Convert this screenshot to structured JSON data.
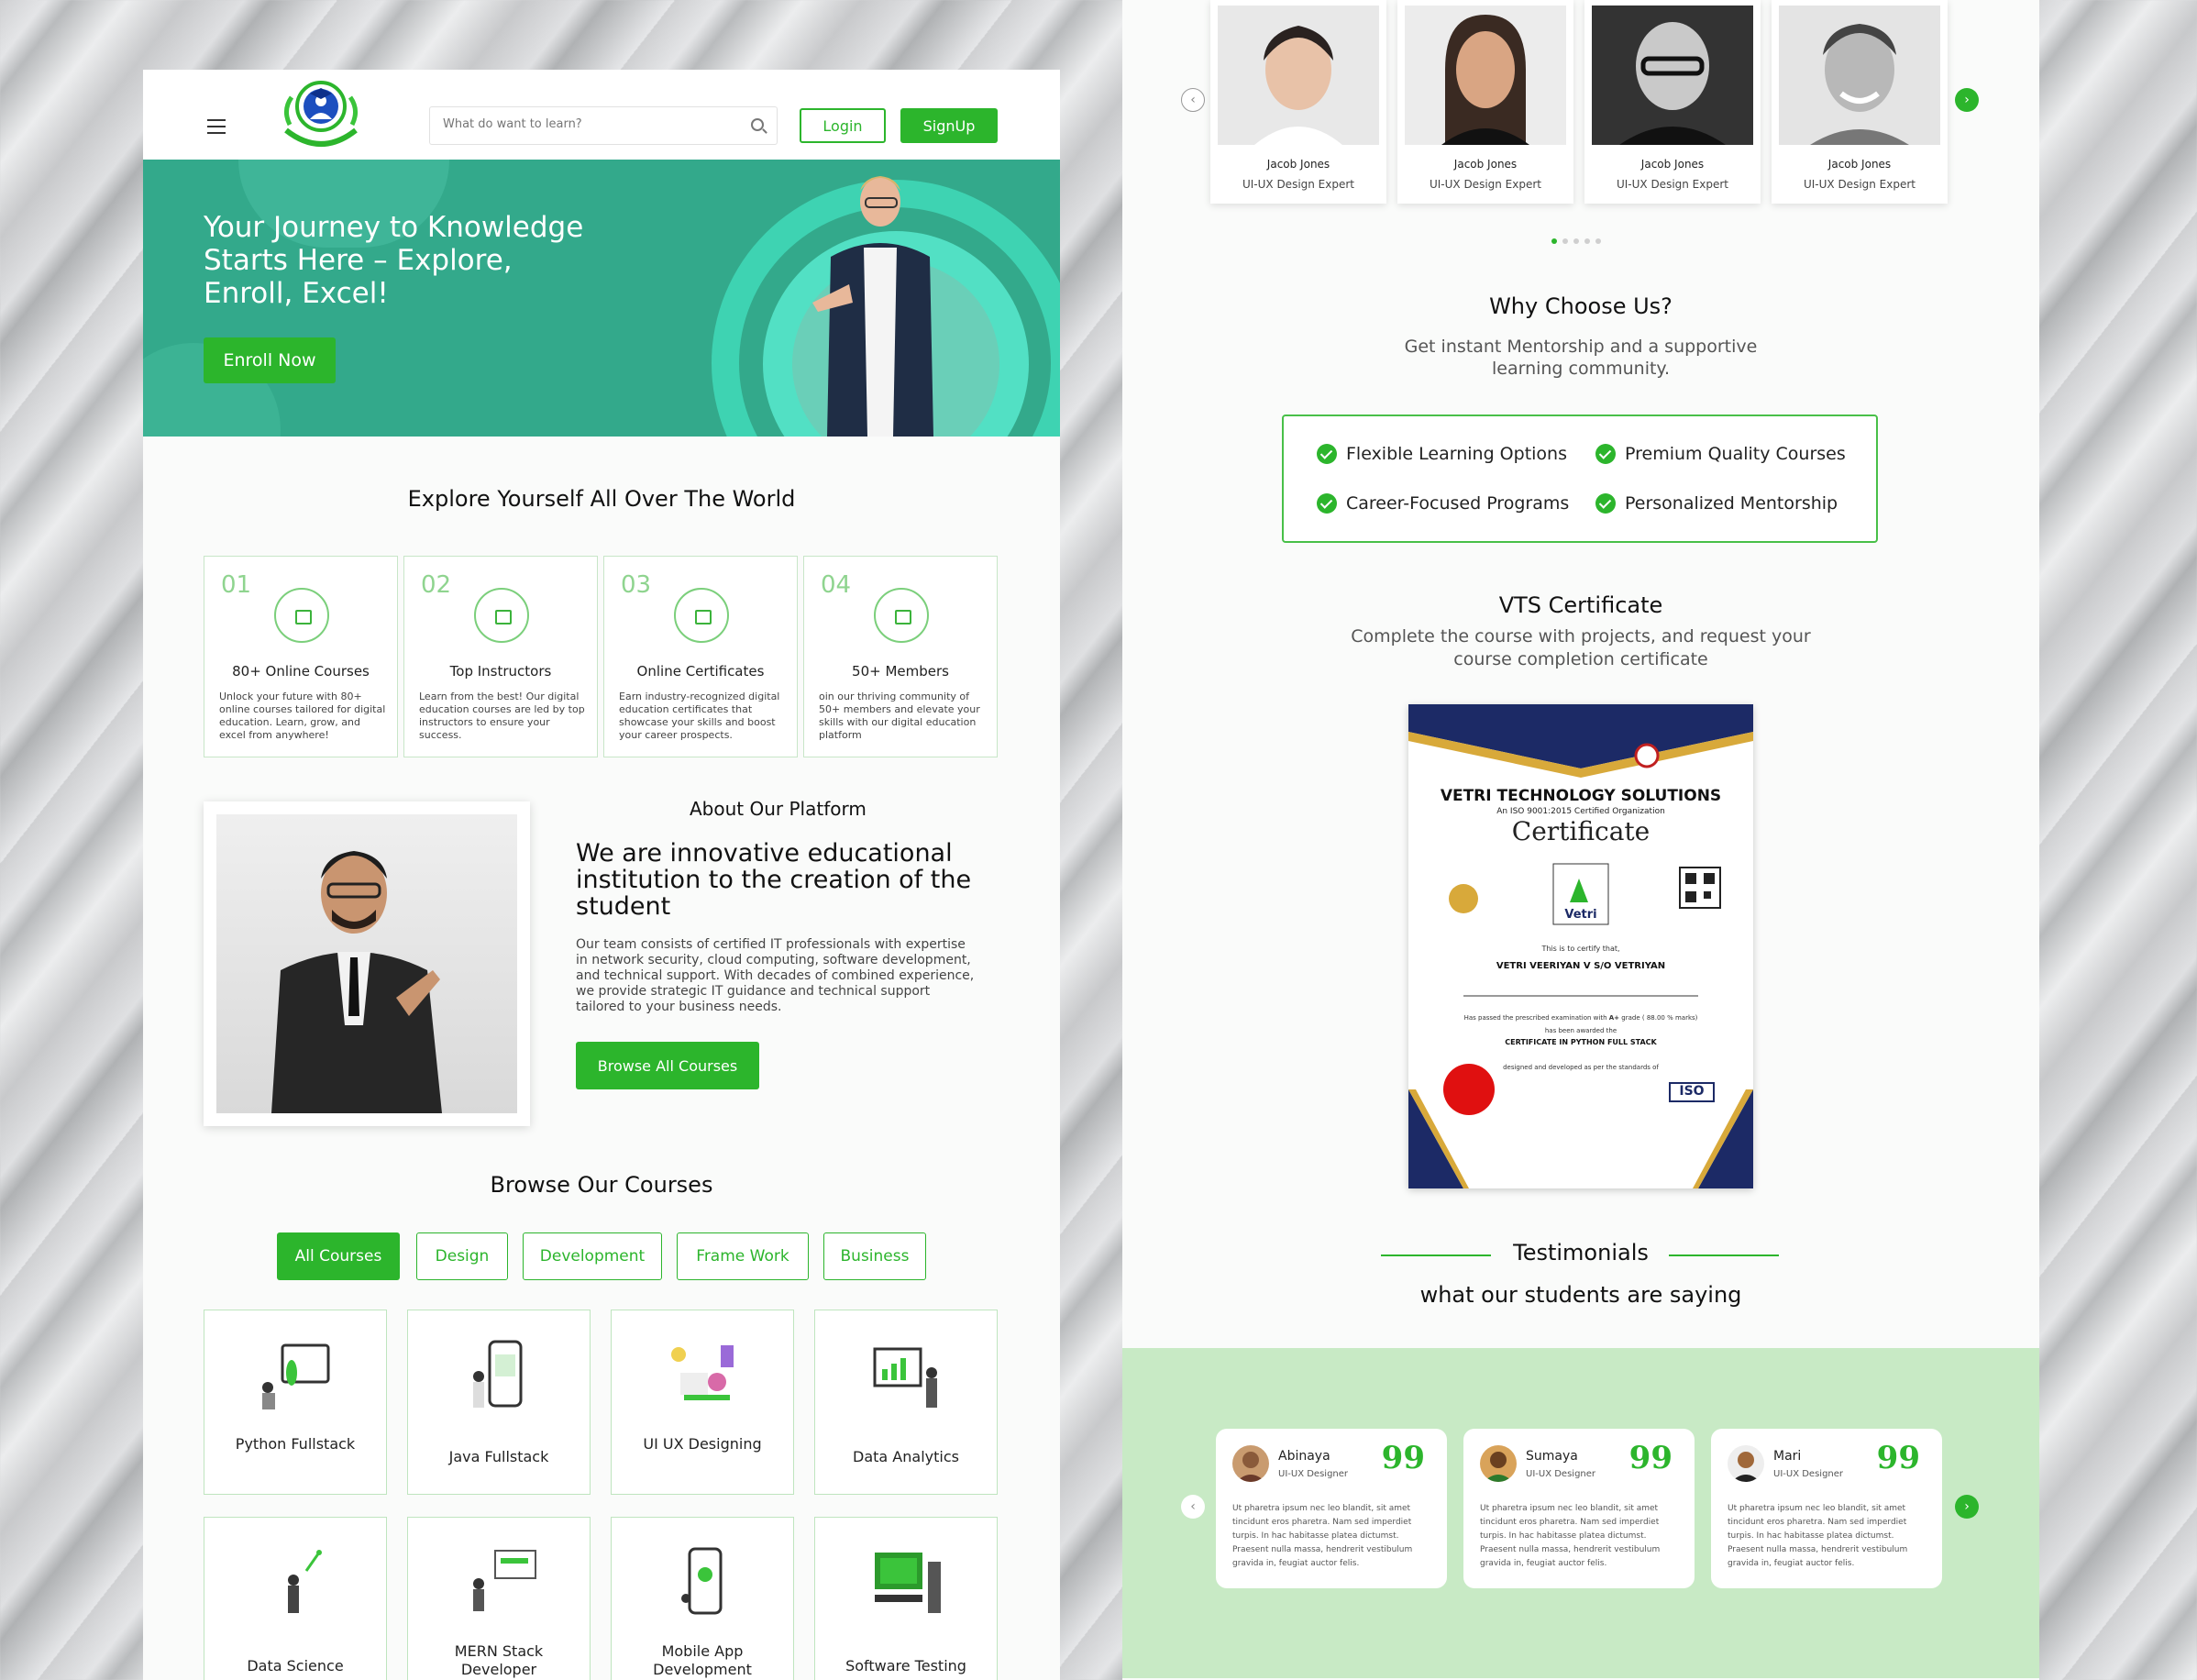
{
  "header": {
    "search_placeholder": "What do want to learn?",
    "login": "Login",
    "signup": "SignUp"
  },
  "hero": {
    "title": "Your Journey to Knowledge Starts Here – Explore, Enroll, Excel!",
    "cta": "Enroll Now"
  },
  "explore": {
    "title": "Explore Yourself All Over The World",
    "features": [
      {
        "num": "01",
        "title": "80+ Online Courses",
        "text": "Unlock your future with 80+ online courses tailored for digital education. Learn, grow, and excel from anywhere!"
      },
      {
        "num": "02",
        "title": "Top Instructors",
        "text": "Learn from the best! Our digital education courses are led by top instructors to ensure your success."
      },
      {
        "num": "03",
        "title": "Online Certificates",
        "text": "Earn industry-recognized digital education certificates that showcase your skills and boost your career prospects."
      },
      {
        "num": "04",
        "title": "50+  Members",
        "text": "oin our thriving community of 50+ members and elevate your skills with our digital education platform"
      }
    ]
  },
  "about": {
    "label": "About Our Platform",
    "heading": "We are innovative educational institution to the creation of the student",
    "text": "Our team consists of certified IT professionals with expertise in network security, cloud computing, software development, and technical support. With decades of combined experience, we provide strategic IT guidance and technical support tailored to your business needs.",
    "cta": "Browse All Courses"
  },
  "courses": {
    "title": "Browse Our Courses",
    "filters": [
      "All Courses",
      "Design",
      "Development",
      "Frame Work",
      "Business"
    ],
    "items": [
      "Python Fullstack",
      "Java Fullstack",
      "UI UX Designing",
      "Data Analytics",
      "Data Science",
      "MERN Stack Developer",
      "Mobile App Development",
      "Software Testing"
    ]
  },
  "instructors": [
    {
      "name": "Jacob Jones",
      "role": "UI-UX Design Expert"
    },
    {
      "name": "Jacob Jones",
      "role": "UI-UX Design Expert"
    },
    {
      "name": "Jacob Jones",
      "role": "UI-UX Design Expert"
    },
    {
      "name": "Jacob Jones",
      "role": "UI-UX Design Expert"
    }
  ],
  "why": {
    "title": "Why Choose Us?",
    "subtitle": "Get instant Mentorship and a supportive learning community.",
    "items": [
      "Flexible Learning Options",
      "Premium Quality Courses",
      "Career-Focused Programs",
      "Personalized Mentorship"
    ]
  },
  "certificate": {
    "title": "VTS Certificate",
    "subtitle": "Complete the course with projects, and request your course completion certificate",
    "org": "VETRI TECHNOLOGY SOLUTIONS",
    "iso": "An ISO 9001:2015 Certified Organization",
    "heading": "Certificate",
    "brand": "Vetri",
    "certify": "This is to certify that,",
    "student": "VETRI VEERIYAN V S/O VETRIYAN",
    "result_prefix": "Has passed the prescribed examination with",
    "grade": "A+",
    "marks": "grade ( 88.00 % marks)",
    "awarded": "has been awarded the",
    "course": "CERTIFICATE IN PYTHON FULL STACK",
    "designed": "designed and developed as per the standards of",
    "iso_badge": "ISO"
  },
  "testimonials": {
    "title": "Testimonials",
    "subtitle": "what our students are saying",
    "items": [
      {
        "name": "Abinaya",
        "role": "UI-UX Designer",
        "text": "Ut pharetra ipsum nec leo blandit, sit amet tincidunt eros pharetra. Nam sed imperdiet turpis. In hac habitasse platea dictumst. Praesent nulla massa, hendrerit vestibulum gravida in, feugiat auctor felis."
      },
      {
        "name": "Sumaya",
        "role": "UI-UX Designer",
        "text": "Ut pharetra ipsum nec leo blandit, sit amet tincidunt eros pharetra. Nam sed imperdiet turpis. In hac habitasse platea dictumst. Praesent nulla massa, hendrerit vestibulum gravida in, feugiat auctor felis."
      },
      {
        "name": "Mari",
        "role": "UI-UX Designer",
        "text": "Ut pharetra ipsum nec leo blandit, sit amet tincidunt eros pharetra. Nam sed imperdiet turpis. In hac habitasse platea dictumst. Praesent nulla massa, hendrerit vestibulum gravida in, feugiat auctor felis."
      }
    ],
    "quote_mark": "99"
  },
  "colors": {
    "accent": "#2cb52c",
    "hero": "#33a98b",
    "band": "#c8eac5"
  },
  "icons": [
    "menu-icon",
    "search-icon",
    "chevron-left-icon",
    "chevron-right-icon",
    "check-circle-icon",
    "quote-icon"
  ]
}
